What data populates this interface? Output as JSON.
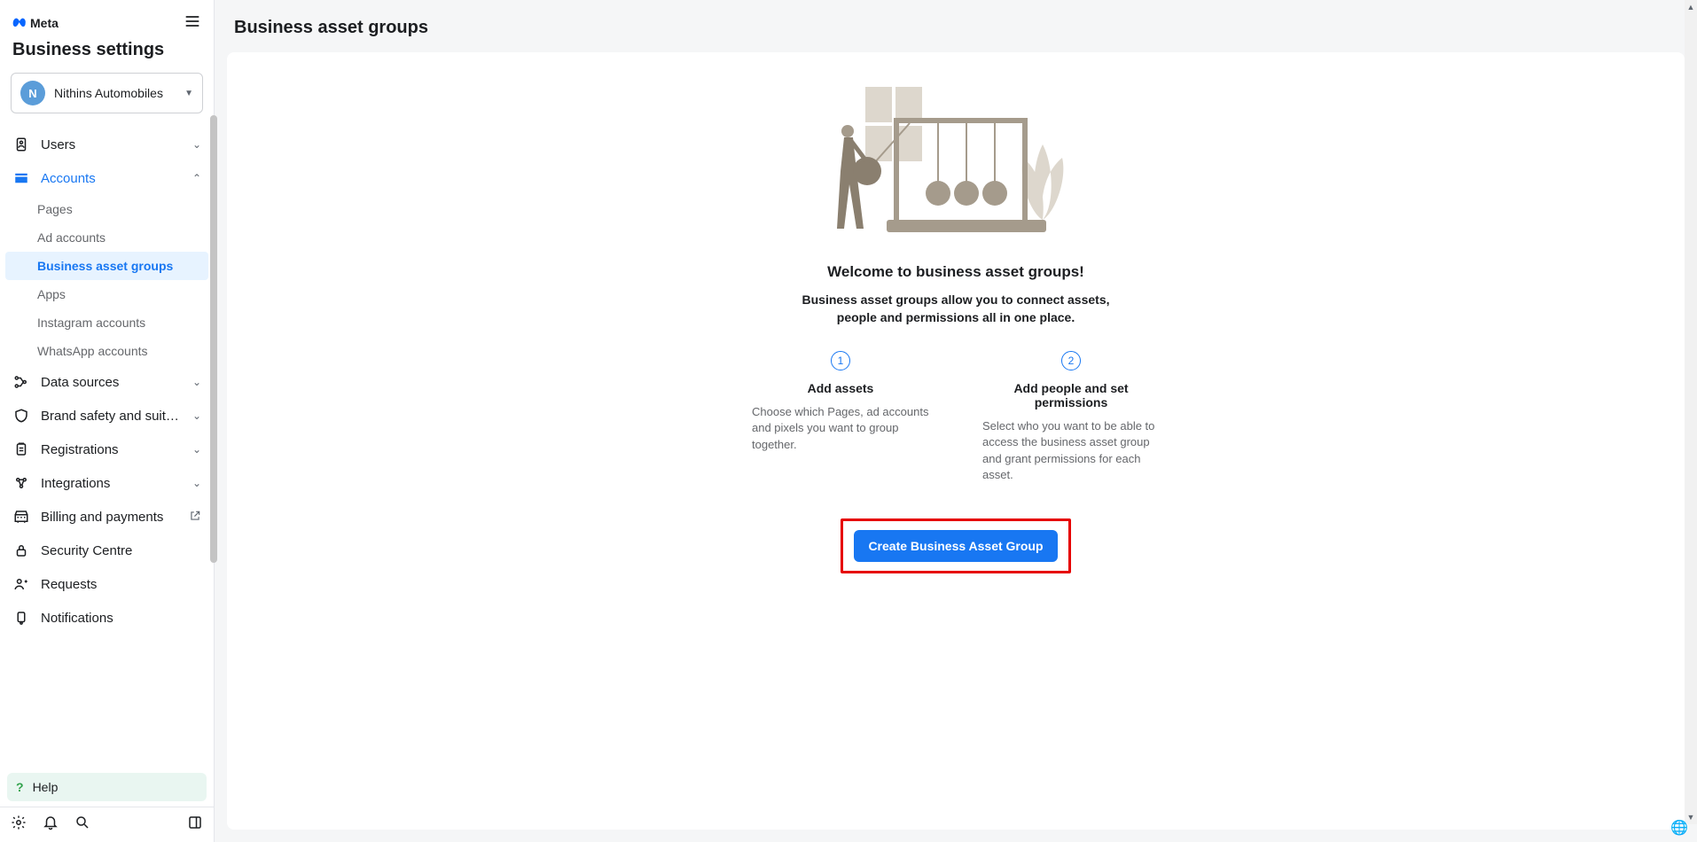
{
  "brand": "Meta",
  "sidebar": {
    "title": "Business settings",
    "business": {
      "initial": "N",
      "name": "Nithins Automobiles"
    },
    "nav": {
      "users": "Users",
      "accounts": "Accounts",
      "accounts_children": {
        "pages": "Pages",
        "ad_accounts": "Ad accounts",
        "bag": "Business asset groups",
        "apps": "Apps",
        "instagram": "Instagram accounts",
        "whatsapp": "WhatsApp accounts"
      },
      "data_sources": "Data sources",
      "brand_safety": "Brand safety and suitabil…",
      "registrations": "Registrations",
      "integrations": "Integrations",
      "billing": "Billing and payments",
      "security": "Security Centre",
      "requests": "Requests",
      "notifications": "Notifications"
    },
    "help": "Help"
  },
  "main": {
    "page_title": "Business asset groups",
    "welcome_heading": "Welcome to business asset groups!",
    "welcome_sub": "Business asset groups allow you to connect assets, people and permissions all in one place.",
    "steps": [
      {
        "num": "1",
        "title": "Add assets",
        "desc": "Choose which Pages, ad accounts and pixels you want to group together."
      },
      {
        "num": "2",
        "title": "Add people and set permissions",
        "desc": "Select who you want to be able to access the business asset group and grant permissions for each asset."
      }
    ],
    "cta": "Create Business Asset Group"
  }
}
